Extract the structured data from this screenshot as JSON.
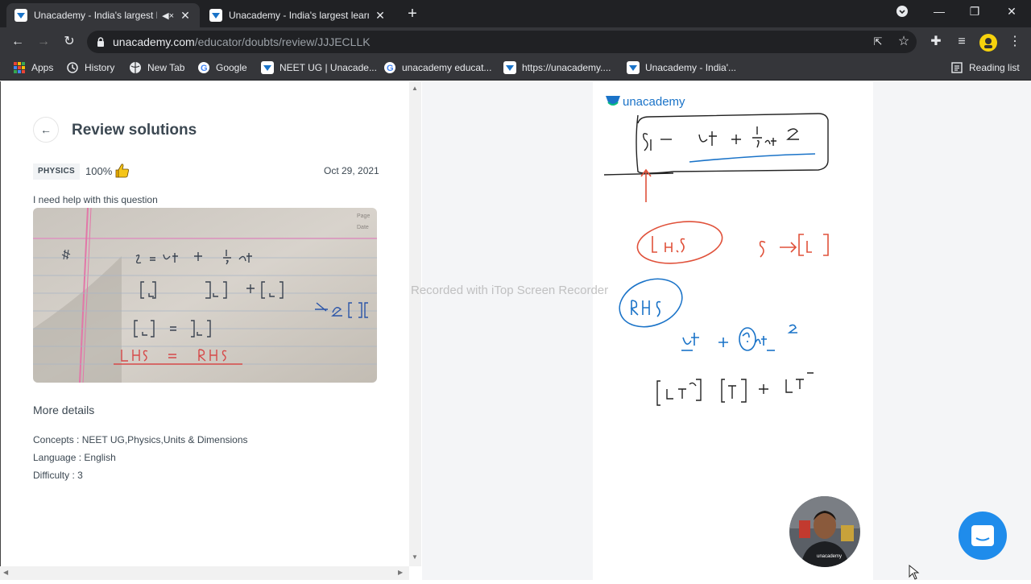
{
  "browser": {
    "tabs": [
      {
        "title": "Unacademy - India's largest l",
        "active": true,
        "muted": true
      },
      {
        "title": "Unacademy - India's largest learn",
        "active": false
      }
    ],
    "address": {
      "host": "unacademy.com",
      "path": "/educator/doubts/review/JJJECLLK"
    },
    "bookmarks": [
      {
        "label": "Apps",
        "icon": "apps-grid-icon"
      },
      {
        "label": "History",
        "icon": "history-icon"
      },
      {
        "label": "New Tab",
        "icon": "globe-icon"
      },
      {
        "label": "Google",
        "icon": "google-icon"
      },
      {
        "label": "NEET UG | Unacade...",
        "icon": "unacademy-icon"
      },
      {
        "label": "unacademy educat...",
        "icon": "google-icon"
      },
      {
        "label": "https://unacademy....",
        "icon": "unacademy-icon"
      },
      {
        "label": "Unacademy - India'...",
        "icon": "unacademy-icon"
      }
    ],
    "reading_list": "Reading list"
  },
  "review": {
    "title": "Review solutions",
    "subject": "PHYSICS",
    "rating": "100%",
    "date": "Oct 29, 2021",
    "question": "I need help with this question",
    "more_details": "More details",
    "concepts": "Concepts : NEET UG,Physics,Units & Dimensions",
    "language": "Language : English",
    "difficulty": "Difficulty : 3"
  },
  "whiteboard": {
    "logo": "unacademy",
    "watermark": "Recorded with iTop Screen Recorder"
  },
  "colors": {
    "brand": "#08bd80",
    "chat": "#1f8ceb",
    "ink_blue": "#1a73c8",
    "ink_red": "#e0513a"
  }
}
